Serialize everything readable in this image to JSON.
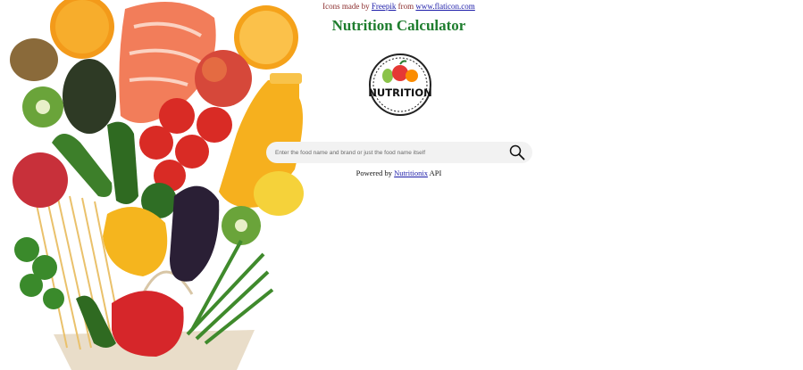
{
  "credit": {
    "prefix": "Icons made by",
    "author_link": "Freepik",
    "middle": "from",
    "site_link": "www.flaticon.com"
  },
  "title": "Nutrition Calculator",
  "logo": {
    "text": "NUTRITION",
    "icon": "fruit-basket-icon"
  },
  "search": {
    "placeholder": "Enter the food name and brand or just the food name itself",
    "icon": "search-icon"
  },
  "powered": {
    "prefix": "Powered by",
    "link": "Nutritionix",
    "suffix": "API"
  },
  "colors": {
    "title": "#1e7d2e",
    "credit_text": "#8b2d2d",
    "link": "#1a1aa8",
    "search_bg": "#f2f2f2"
  }
}
